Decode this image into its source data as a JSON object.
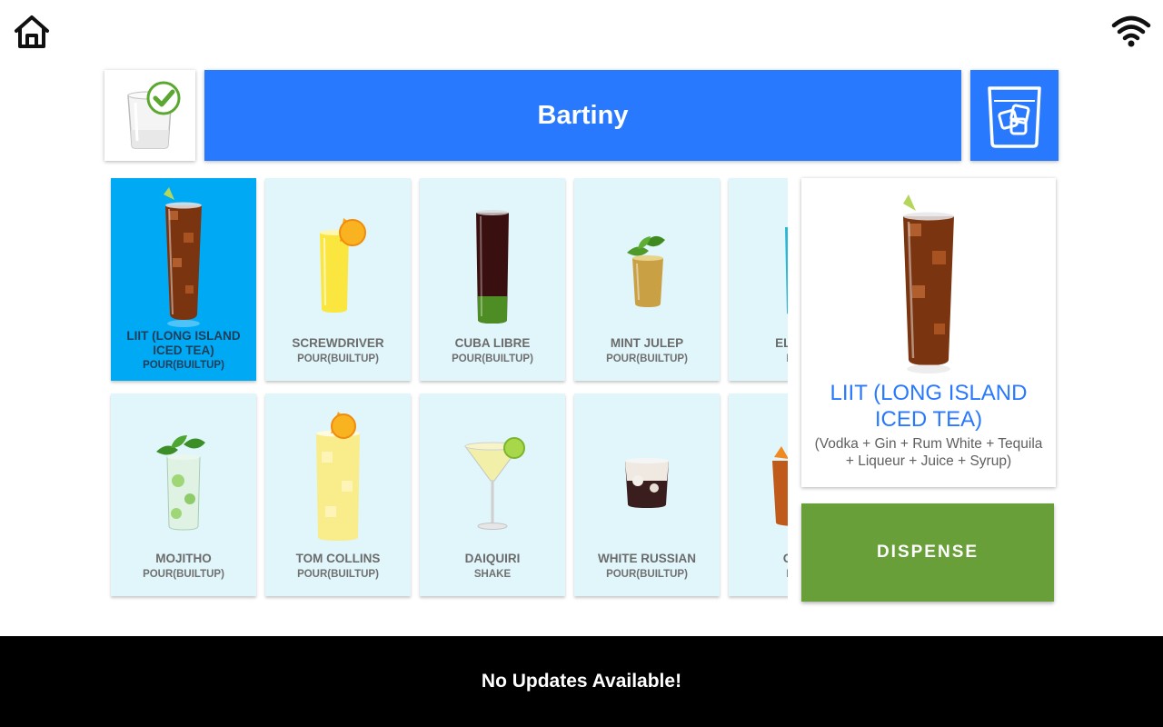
{
  "header": {
    "home_icon": "home-icon",
    "wifi_icon": "wifi-icon"
  },
  "glass_status": {
    "icon": "glass-check-icon",
    "check_color": "#4caf50"
  },
  "title": "Bartiny",
  "ice_button": {
    "icon": "ice-glass-icon"
  },
  "colors": {
    "accent": "#2979ff",
    "tile_bg": "#e0f6fb",
    "tile_selected": "#00a9f4",
    "dispense": "#689f38",
    "status_bar": "#000000"
  },
  "drinks": [
    {
      "name": "LIIT (LONG ISLAND ICED TEA)",
      "method": "POUR(BUILTUP)",
      "selected": true
    },
    {
      "name": "SCREWDRIVER",
      "method": "POUR(BUILTUP)"
    },
    {
      "name": "CUBA LIBRE",
      "method": "POUR(BUILTUP)"
    },
    {
      "name": "MINT JULEP",
      "method": "POUR(BUILTUP)"
    },
    {
      "name": "ELECTRI",
      "method": "POUR"
    },
    {
      "name": "MOJITHO",
      "method": "POUR(BUILTUP)"
    },
    {
      "name": "TOM COLLINS",
      "method": "POUR(BUILTUP)"
    },
    {
      "name": "DAIQUIRI",
      "method": "SHAKE"
    },
    {
      "name": "WHITE RUSSIAN",
      "method": "POUR(BUILTUP)"
    },
    {
      "name": "OLD F",
      "method": "POUR"
    }
  ],
  "detail": {
    "name": "LIIT (LONG ISLAND ICED TEA)",
    "ingredients": "(Vodka + Gin + Rum White + Tequila + Liqueur + Juice + Syrup)"
  },
  "dispense_label": "DISPENSE",
  "status_message": "No Updates Available!"
}
